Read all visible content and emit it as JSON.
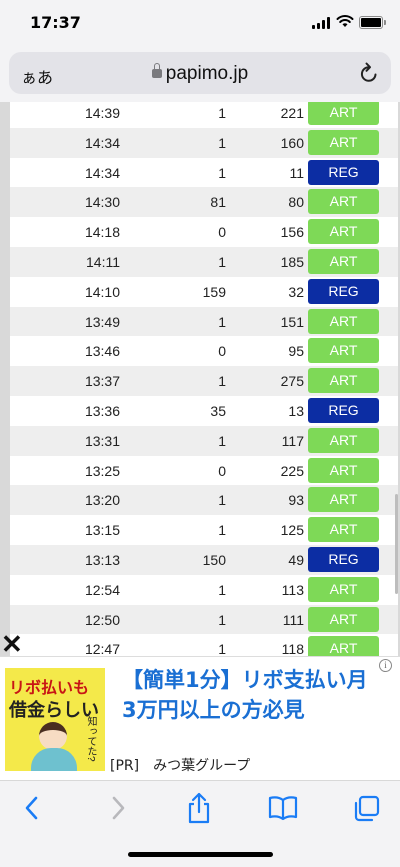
{
  "status_bar": {
    "time": "17:37"
  },
  "address_bar": {
    "text_size_label": "ぁあ",
    "host": "papimo.jp"
  },
  "history_rows": [
    {
      "time": "14:39",
      "games_between": "1",
      "games": "221",
      "type": "ART"
    },
    {
      "time": "14:34",
      "games_between": "1",
      "games": "160",
      "type": "ART"
    },
    {
      "time": "14:34",
      "games_between": "1",
      "games": "11",
      "type": "REG"
    },
    {
      "time": "14:30",
      "games_between": "81",
      "games": "80",
      "type": "ART"
    },
    {
      "time": "14:18",
      "games_between": "0",
      "games": "156",
      "type": "ART"
    },
    {
      "time": "14:11",
      "games_between": "1",
      "games": "185",
      "type": "ART"
    },
    {
      "time": "14:10",
      "games_between": "159",
      "games": "32",
      "type": "REG"
    },
    {
      "time": "13:49",
      "games_between": "1",
      "games": "151",
      "type": "ART"
    },
    {
      "time": "13:46",
      "games_between": "0",
      "games": "95",
      "type": "ART"
    },
    {
      "time": "13:37",
      "games_between": "1",
      "games": "275",
      "type": "ART"
    },
    {
      "time": "13:36",
      "games_between": "35",
      "games": "13",
      "type": "REG"
    },
    {
      "time": "13:31",
      "games_between": "1",
      "games": "117",
      "type": "ART"
    },
    {
      "time": "13:25",
      "games_between": "0",
      "games": "225",
      "type": "ART"
    },
    {
      "time": "13:20",
      "games_between": "1",
      "games": "93",
      "type": "ART"
    },
    {
      "time": "13:15",
      "games_between": "1",
      "games": "125",
      "type": "ART"
    },
    {
      "time": "13:13",
      "games_between": "150",
      "games": "49",
      "type": "REG"
    },
    {
      "time": "12:54",
      "games_between": "1",
      "games": "113",
      "type": "ART"
    },
    {
      "time": "12:50",
      "games_between": "1",
      "games": "111",
      "type": "ART"
    },
    {
      "time": "12:47",
      "games_between": "1",
      "games": "118",
      "type": "ART"
    }
  ],
  "colors": {
    "art": "#7ed957",
    "reg": "#0c2da3",
    "row_alt": "#eeeeee"
  },
  "ad": {
    "close_glyph": "✕",
    "thumb_line1": "リボ払いも",
    "thumb_line2": "借金らしい",
    "thumb_line3": "知ってた?",
    "headline": "【簡単1分】リボ支払い月3万円以上の方必見",
    "sponsor": "[PR]　みつ葉グループ",
    "info_glyph": "i"
  },
  "toolbar": {
    "items": [
      "back-icon",
      "forward-icon",
      "share-icon",
      "bookmarks-icon",
      "tabs-icon"
    ]
  }
}
